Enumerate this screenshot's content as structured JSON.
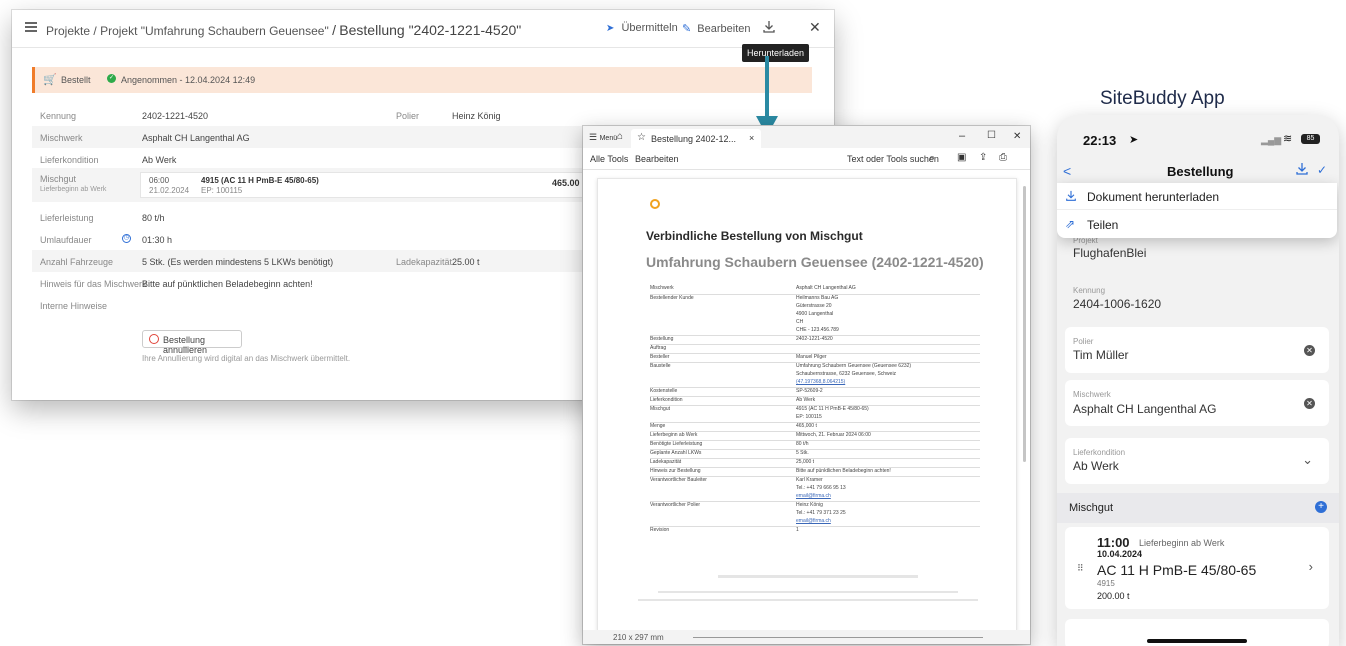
{
  "web": {
    "breadcrumb": {
      "projects": "Projekte",
      "sep1": "/",
      "project": "Projekt \"Umfahrung Schaubern Geuensee\"",
      "sep2": "/",
      "order": "Bestellung \"2402-1221-4520\""
    },
    "actions": {
      "submit": "Übermitteln",
      "edit": "Bearbeiten"
    },
    "tooltip": "Herunterladen",
    "status": {
      "ordered": "Bestellt",
      "accepted": "Angenommen - 12.04.2024 12:49"
    },
    "fields": [
      {
        "label": "Kennung",
        "value": "2402-1221-4520",
        "extra_label": "Polier",
        "extra_value": "Heinz König"
      },
      {
        "label": "Mischwerk",
        "value": "Asphalt CH Langenthal AG"
      },
      {
        "label": "Lieferkondition",
        "value": "Ab Werk"
      }
    ],
    "mischgut": {
      "label": "Mischgut",
      "sublabel": "Lieferbeginn ab Werk",
      "time": "06:00",
      "date": "21.02.2024",
      "product": "4915 (AC 11 H PmB-E 45/80-65)",
      "ep": "EP: 100115",
      "amount": "465.00 t"
    },
    "fields2": [
      {
        "label": "Lieferleistung",
        "value": "80 t/h"
      },
      {
        "label": "Umlaufdauer",
        "value": "01:30 h"
      },
      {
        "label": "Anzahl Fahrzeuge",
        "value": "5 Stk.   (Es werden mindestens 5 LKWs benötigt)",
        "extra_label": "Ladekapazität",
        "extra_value": "25.00 t"
      },
      {
        "label": "Hinweis für das Mischwerk",
        "value": "Bitte auf pünktlichen Beladebeginn achten!"
      },
      {
        "label": "Interne Hinweise",
        "value": ""
      }
    ],
    "cancel_label": "Bestellung annullieren",
    "cancel_note": "Ihre Annullierung wird digital an das Mischwerk übermittelt."
  },
  "pdf": {
    "menu_label": "Menü",
    "tab_title": "Bestellung 2402-12...",
    "tab_close": "×",
    "win_minimize": "–",
    "win_maximize": "☐",
    "win_close": "✕",
    "tools": {
      "all_tools": "Alle Tools",
      "edit": "Bearbeiten",
      "search": "Text oder Tools suchen"
    },
    "heading": "Verbindliche Bestellung von Mischgut",
    "subheading": "Umfahrung Schaubern Geuensee (2402-1221-4520)",
    "rows": [
      {
        "k": "Mischwerk",
        "v": [
          "Asphalt CH Langenthal AG"
        ]
      },
      {
        "k": "Bestellender Kunde",
        "v": [
          "Heilmanns Bau AG",
          "Güterstrasse 20",
          "4900 Langenthal",
          "CH",
          "CHE - 123.456.789"
        ]
      },
      {
        "k": "Bestellung",
        "v": [
          "2402-1221-4520"
        ]
      },
      {
        "k": "Auftrag",
        "v": [
          ""
        ]
      },
      {
        "k": "Besteller",
        "v": [
          "Manuel Pilger"
        ]
      },
      {
        "k": "Baustelle",
        "v": [
          "Umfahrung Schaubern Geuensee (Geuensee 6232)",
          "Schaubernstrasse, 6232 Geuensee, Schweiz",
          "(47.197368,8.064215)"
        ]
      },
      {
        "k": "Kostenstelle",
        "v": [
          "SP-52609-2"
        ]
      },
      {
        "k": "Lieferkondition",
        "v": [
          "Ab Werk"
        ]
      },
      {
        "k": "Mischgut",
        "v": [
          "4915 (AC 11 H PmB-E 45/80-65)",
          "EP: 100115"
        ]
      },
      {
        "k": "Menge",
        "v": [
          "465,000 t"
        ]
      },
      {
        "k": "Lieferbeginn ab Werk",
        "v": [
          "Mittwoch, 21. Februar 2024 06:00"
        ]
      },
      {
        "k": "Benötigte Lieferleistung",
        "v": [
          "80 t/h"
        ]
      },
      {
        "k": "Geplante Anzahl LKWs",
        "v": [
          "5 Stk."
        ]
      },
      {
        "k": "Ladekapazität",
        "v": [
          "25,000 t"
        ]
      },
      {
        "k": "Hinweis zur Bestellung",
        "v": [
          "Bitte auf pünktlichen Beladebeginn achten!"
        ]
      },
      {
        "k": "Verantwortlicher Bauleiter",
        "v": [
          "Karl Kramer",
          "Tel.: +41 79 666 95 13",
          "email@firma.ch"
        ]
      },
      {
        "k": "Verantwortlicher Polier",
        "v": [
          "Heinz König",
          "Tel.: +41 79 371 23 25",
          "email@firma.ch"
        ]
      },
      {
        "k": "Revision",
        "v": [
          "1"
        ]
      }
    ],
    "page_size": "210 x 297 mm"
  },
  "phone": {
    "brand": "SiteBuddy App",
    "time": "22:13",
    "battery": "85",
    "back": "<",
    "title": "Bestellung",
    "menu": {
      "download": "Dokument herunterladen",
      "share": "Teilen"
    },
    "project_label": "Projekt",
    "project_value": "FlughafenBlei",
    "id_label": "Kennung",
    "id_value": "2404-1006-1620",
    "polier_label": "Polier",
    "polier_value": "Tim Müller",
    "mischwerk_label": "Mischwerk",
    "mischwerk_value": "Asphalt CH Langenthal AG",
    "kondition_label": "Lieferkondition",
    "kondition_value": "Ab Werk",
    "section": "Mischgut",
    "item": {
      "time": "11:00",
      "time_label": "Lieferbeginn ab Werk",
      "date": "10.04.2024",
      "product": "AC 11 H PmB-E 45/80-65",
      "code": "4915",
      "amount": "200.00 t"
    }
  },
  "colors": {
    "accent_orange": "#f07c2a",
    "accent_teal": "#2a8aa3",
    "status_bg": "#fbe6d8",
    "link_blue": "#3b68b8",
    "phone_blue": "#2f6fd6"
  }
}
